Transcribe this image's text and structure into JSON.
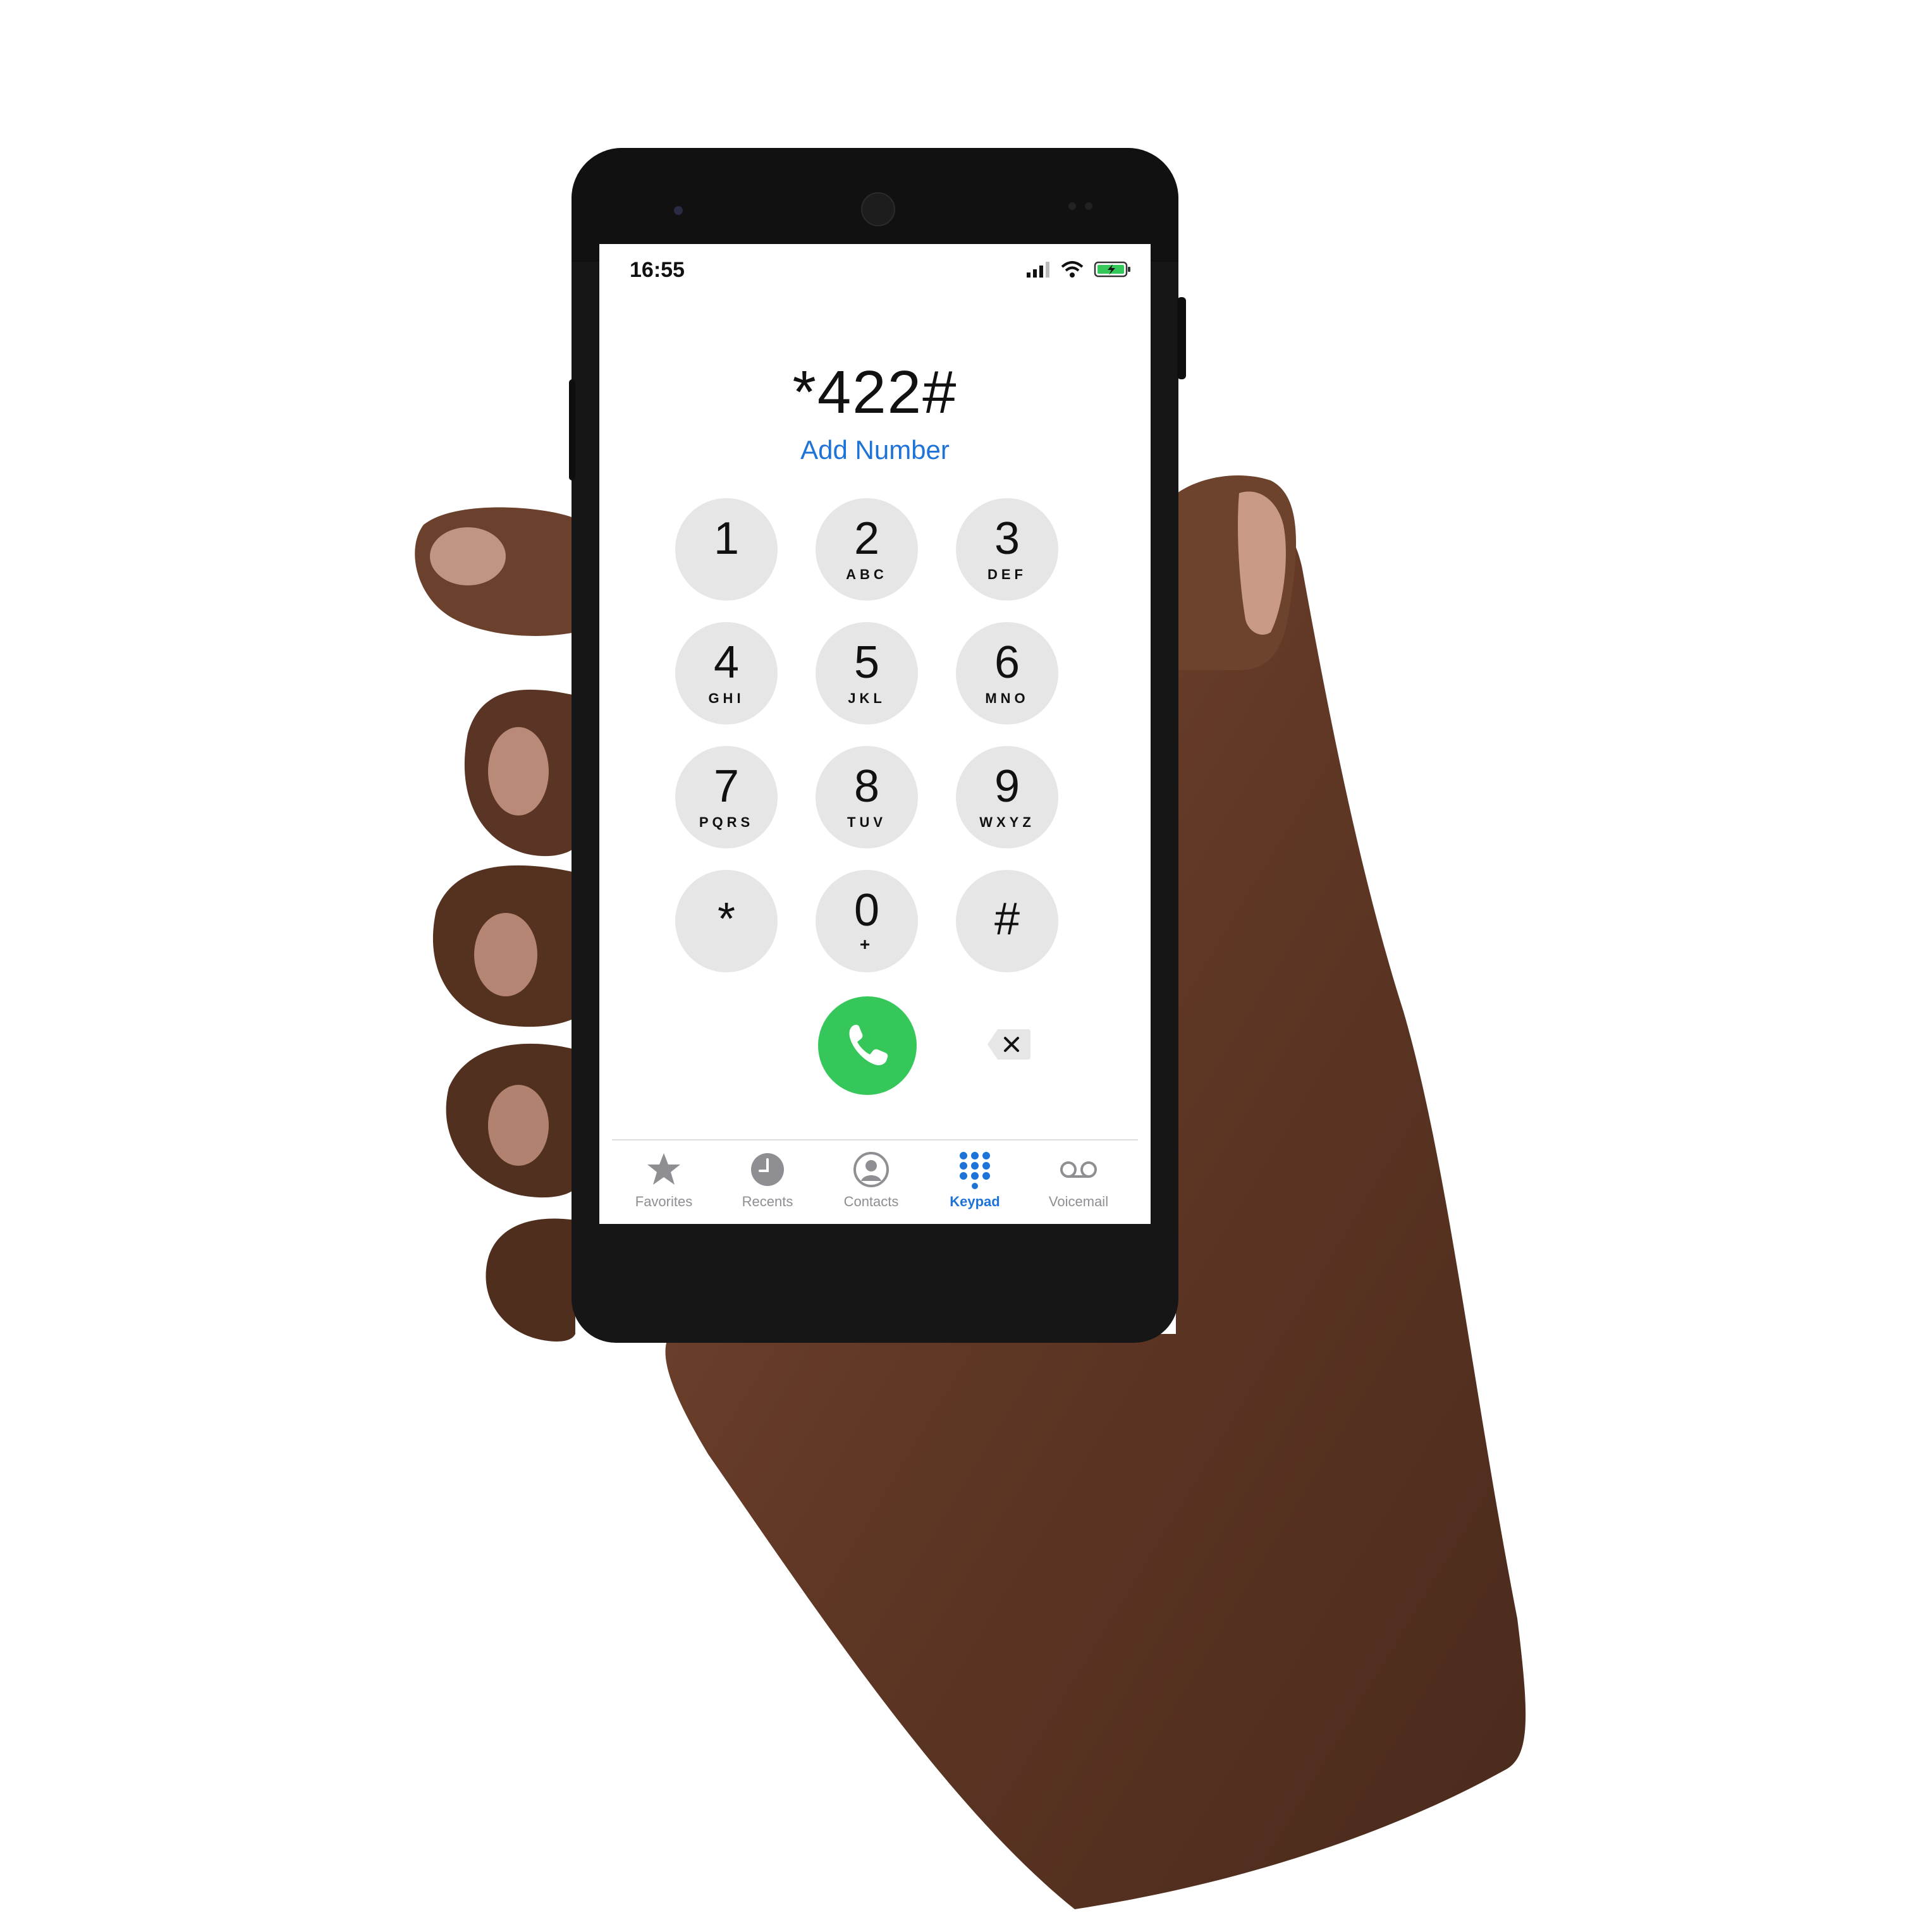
{
  "status_bar": {
    "time": "16:55",
    "icons": [
      "signal-icon",
      "wifi-icon",
      "battery-charging-icon"
    ]
  },
  "dialer": {
    "entered_number": "*422#",
    "add_number_label": "Add Number"
  },
  "keypad": [
    {
      "num": "1",
      "letters": ""
    },
    {
      "num": "2",
      "letters": "ABC"
    },
    {
      "num": "3",
      "letters": "DEF"
    },
    {
      "num": "4",
      "letters": "GHI"
    },
    {
      "num": "5",
      "letters": "JKL"
    },
    {
      "num": "6",
      "letters": "MNO"
    },
    {
      "num": "7",
      "letters": "PQRS"
    },
    {
      "num": "8",
      "letters": "TUV"
    },
    {
      "num": "9",
      "letters": "WXYZ"
    },
    {
      "num": "*",
      "letters": ""
    },
    {
      "num": "0",
      "letters": "+"
    },
    {
      "num": "#",
      "letters": ""
    }
  ],
  "actions": {
    "call_icon": "phone-icon",
    "delete_icon": "backspace-icon"
  },
  "tabs": [
    {
      "label": "Favorites",
      "icon": "star-icon",
      "active": false
    },
    {
      "label": "Recents",
      "icon": "clock-icon",
      "active": false
    },
    {
      "label": "Contacts",
      "icon": "person-circle-icon",
      "active": false
    },
    {
      "label": "Keypad",
      "icon": "keypad-grid-icon",
      "active": true
    },
    {
      "label": "Voicemail",
      "icon": "voicemail-icon",
      "active": false
    }
  ],
  "colors": {
    "accent": "#1e73d8",
    "call_green": "#35c759",
    "key_gray": "#e6e6e6",
    "skin": "#6b3f2a",
    "phone_body": "#161616"
  }
}
